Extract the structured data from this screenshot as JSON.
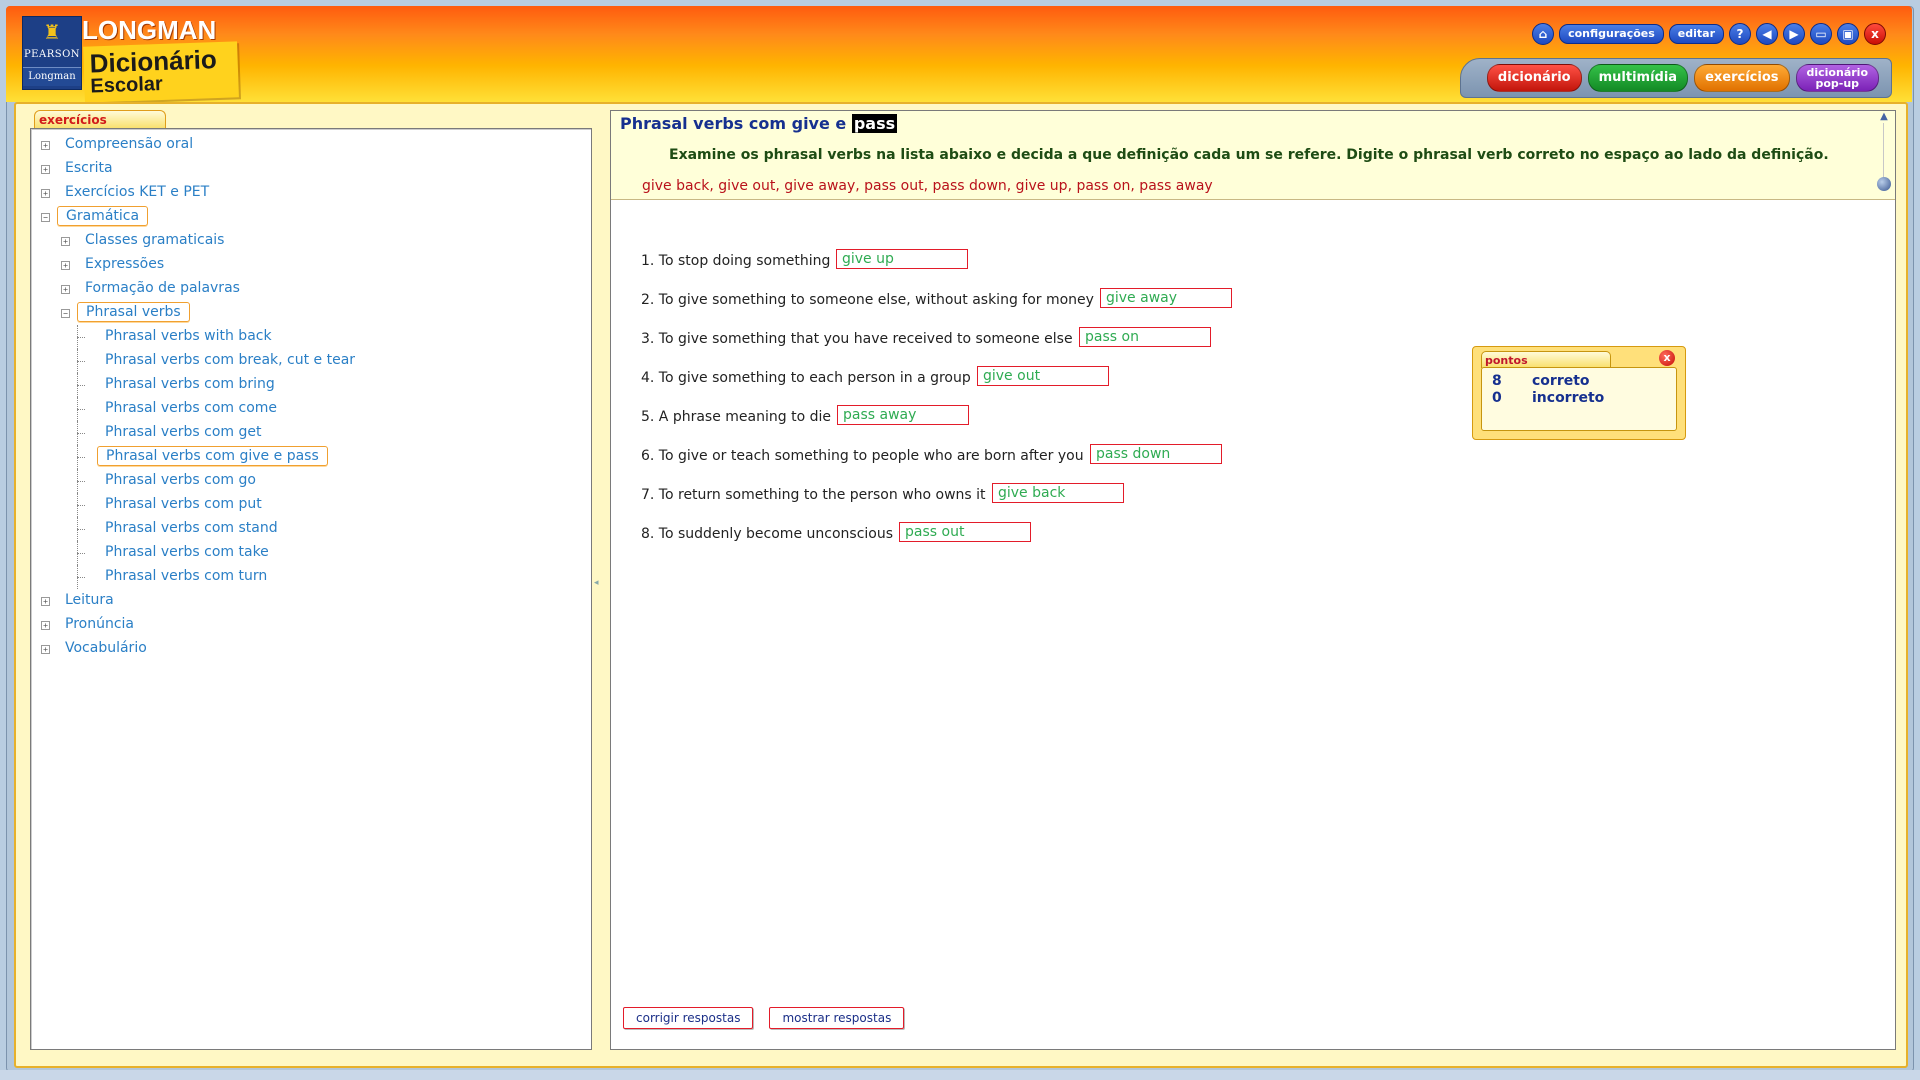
{
  "brand": {
    "publisher_top": "PEARSON",
    "publisher_bottom": "Longman",
    "title": "LONGMAN",
    "subtitle_1": "Dicionário",
    "subtitle_2": "Escolar"
  },
  "toolbar": {
    "settings": "configurações",
    "edit": "editar",
    "help": "?",
    "close": "x"
  },
  "nav_tabs": [
    "dicionário",
    "multimídia",
    "exercícios"
  ],
  "nav_tab_popup": [
    "dicionário",
    "pop-up"
  ],
  "left_panel": {
    "tab_title": "exercícios",
    "tree": [
      {
        "label": "Compreensão oral",
        "level": 0,
        "expander": "+"
      },
      {
        "label": "Escrita",
        "level": 0,
        "expander": "+"
      },
      {
        "label": "Exercícios KET e PET",
        "level": 0,
        "expander": "+"
      },
      {
        "label": "Gramática",
        "level": 0,
        "expander": "−",
        "selected": true
      },
      {
        "label": "Classes gramaticais",
        "level": 1,
        "expander": "+"
      },
      {
        "label": "Expressões",
        "level": 1,
        "expander": "+"
      },
      {
        "label": "Formação de palavras",
        "level": 1,
        "expander": "+"
      },
      {
        "label": "Phrasal verbs",
        "level": 1,
        "expander": "−",
        "selected": true
      },
      {
        "label": "Phrasal verbs with back",
        "level": 2
      },
      {
        "label": "Phrasal verbs com break, cut e tear",
        "level": 2
      },
      {
        "label": "Phrasal verbs com bring",
        "level": 2
      },
      {
        "label": "Phrasal verbs com come",
        "level": 2
      },
      {
        "label": "Phrasal verbs com get",
        "level": 2
      },
      {
        "label": "Phrasal verbs com give e pass",
        "level": 2,
        "selected": true
      },
      {
        "label": "Phrasal verbs com go",
        "level": 2
      },
      {
        "label": "Phrasal verbs com put",
        "level": 2
      },
      {
        "label": "Phrasal verbs com stand",
        "level": 2
      },
      {
        "label": "Phrasal verbs com take",
        "level": 2
      },
      {
        "label": "Phrasal verbs com turn",
        "level": 2
      },
      {
        "label": "Leitura",
        "level": 0,
        "expander": "+"
      },
      {
        "label": "Pronúncia",
        "level": 0,
        "expander": "+"
      },
      {
        "label": "Vocabulário",
        "level": 0,
        "expander": "+"
      }
    ]
  },
  "exercise": {
    "title_prefix": "Phrasal verbs com give e ",
    "title_highlight": "pass",
    "instructions": "Examine os phrasal verbs na lista abaixo e decida a que definição cada um se refere. Digite o phrasal verb correto no espaço ao lado da definição.",
    "word_list": "give back, give out, give away, pass out, pass down, give up, pass on, pass away",
    "questions": [
      {
        "text": "1. To stop doing something",
        "answer": "give up"
      },
      {
        "text": "2. To give something to someone else, without asking for money",
        "answer": "give away"
      },
      {
        "text": "3. To give something that you have received to someone else",
        "answer": "pass on"
      },
      {
        "text": "4. To give something to each person in a group",
        "answer": "give out"
      },
      {
        "text": "5. A phrase meaning to die",
        "answer": "pass away"
      },
      {
        "text": "6. To give or teach something to people who are born after you",
        "answer": "pass down"
      },
      {
        "text": "7. To return something to the person who owns it",
        "answer": "give back"
      },
      {
        "text": "8. To suddenly become unconscious",
        "answer": "pass out"
      }
    ],
    "check_button": "corrigir respostas",
    "show_button": "mostrar respostas"
  },
  "score": {
    "title": "pontos",
    "close": "x",
    "correct_count": "8",
    "correct_label": "correto",
    "incorrect_count": "0",
    "incorrect_label": "incorreto"
  },
  "colors": {
    "header_top": "#ff5b0f",
    "header_bottom": "#ffe037",
    "link_blue": "#2a7fc6",
    "answer_green": "#2fab52",
    "field_red": "#e31c2a"
  }
}
